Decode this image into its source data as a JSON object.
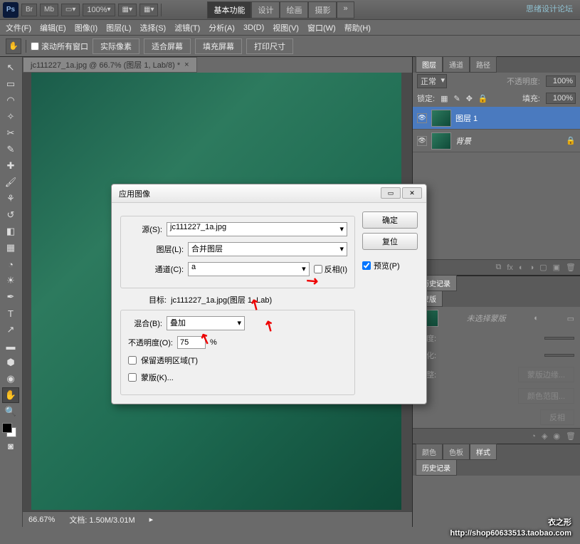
{
  "titlebar": {
    "ps": "Ps",
    "br": "Br",
    "mb": "Mb",
    "zoom": "100%"
  },
  "workspace": {
    "basic": "基本功能",
    "design": "设计",
    "paint": "绘画",
    "photo": "摄影"
  },
  "logo_right": "思绪设计论坛",
  "menu": {
    "file": "文件(F)",
    "edit": "编辑(E)",
    "image": "图像(I)",
    "layer": "图层(L)",
    "select": "选择(S)",
    "filter": "滤镜(T)",
    "analysis": "分析(A)",
    "threed": "3D(D)",
    "view": "视图(V)",
    "window": "窗口(W)",
    "help": "帮助(H)"
  },
  "optbar": {
    "scroll_all": "滚动所有窗口",
    "actual": "实际像素",
    "fit": "适合屏幕",
    "fill": "填充屏幕",
    "print": "打印尺寸"
  },
  "doc_tab": "jc111227_1a.jpg @ 66.7% (图层 1, Lab/8) *",
  "dialog": {
    "title": "应用图像",
    "source_label": "源(S):",
    "source": "jc111227_1a.jpg",
    "layer_label": "图层(L):",
    "layer": "合并图层",
    "channel_label": "通道(C):",
    "channel": "a",
    "invert": "反相(I)",
    "target_label": "目标:",
    "target": "jc111227_1a.jpg(图层 1, Lab)",
    "blend_label": "混合(B):",
    "blend": "叠加",
    "opacity_label": "不透明度(O):",
    "opacity": "75",
    "pct": "%",
    "preserve": "保留透明区域(T)",
    "mask": "蒙版(K)...",
    "ok": "确定",
    "reset": "复位",
    "preview": "预览(P)"
  },
  "layers_panel": {
    "tabs": {
      "layers": "图层",
      "channels": "通道",
      "paths": "路径"
    },
    "mode": "正常",
    "opacity_label": "不透明度:",
    "opacity": "100%",
    "lock_label": "锁定:",
    "fill_label": "填充:",
    "fill": "100%",
    "layer1": "图层 1",
    "bg": "背景"
  },
  "history_tab": "历史记录",
  "mask_panel": {
    "tab": "蒙版",
    "not_selected": "未选择蒙版",
    "density": "浓度:",
    "feather": "羽化:",
    "adjust": "调整:",
    "edge": "蒙版边缘...",
    "color_range": "颜色范围...",
    "invert": "反相"
  },
  "bottom_tabs": {
    "swatch": "颜色",
    "color": "色板",
    "style": "样式"
  },
  "history_tab2": "历史记录",
  "status": {
    "zoom": "66.67%",
    "doc": "文档: 1.50M/3.01M"
  },
  "watermark": {
    "l1": "衣之形",
    "l2": "http://shop60633513.taobao.com"
  }
}
